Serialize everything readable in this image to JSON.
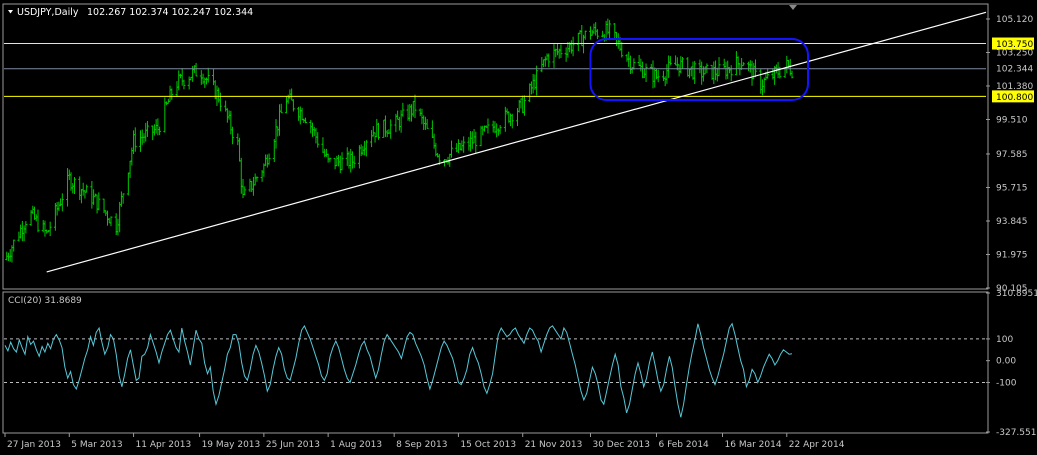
{
  "header": {
    "symbol": "USDJPY,Daily",
    "ohlc": "102.267 102.374 102.247 102.344"
  },
  "colors": {
    "background": "#000000",
    "candles": "#00c800",
    "cci_line": "#56c8d8",
    "support_resistance": "#ffff00",
    "trendline": "#ffffff",
    "range_box": "#1414ff",
    "grid": "#808080"
  },
  "chart_data": [
    {
      "type": "line",
      "title": "",
      "series_name": "USDJPY Daily (approx. closes)",
      "x": [
        "2013-01-27",
        "2013-02-10",
        "2013-02-20",
        "2013-03-05",
        "2013-03-20",
        "2013-04-01",
        "2013-04-11",
        "2013-04-25",
        "2013-05-05",
        "2013-05-19",
        "2013-05-30",
        "2013-06-10",
        "2013-06-13",
        "2013-06-25",
        "2013-07-08",
        "2013-07-20",
        "2013-08-01",
        "2013-08-15",
        "2013-08-25",
        "2013-09-08",
        "2013-09-20",
        "2013-10-05",
        "2013-10-15",
        "2013-10-28",
        "2013-11-08",
        "2013-11-21",
        "2013-12-05",
        "2013-12-18",
        "2013-12-30",
        "2014-01-10",
        "2014-01-23",
        "2014-02-06",
        "2014-02-18",
        "2014-03-02",
        "2014-03-16",
        "2014-03-28",
        "2014-04-07",
        "2014-04-22",
        "2014-04-25"
      ],
      "y": [
        91.7,
        94.3,
        93.1,
        96.2,
        95.0,
        93.6,
        98.3,
        99.0,
        101.5,
        102.3,
        100.8,
        98.1,
        95.1,
        96.9,
        100.7,
        99.6,
        97.1,
        97.2,
        98.8,
        99.2,
        100.2,
        97.3,
        97.8,
        98.6,
        99.4,
        100.3,
        103.0,
        103.6,
        104.4,
        104.4,
        102.6,
        101.9,
        102.6,
        102.1,
        102.2,
        102.8,
        101.5,
        102.5,
        102.3
      ],
      "y_ticks": [
        "105.120",
        "103.250",
        "101.380",
        "99.510",
        "97.585",
        "95.715",
        "93.845",
        "91.975",
        "90.105"
      ],
      "x_ticks": [
        "27 Jan 2013",
        "5 Mar 2013",
        "11 Apr 2013",
        "19 May 2013",
        "25 Jun 2013",
        "1 Aug 2013",
        "8 Sep 2013",
        "15 Oct 2013",
        "21 Nov 2013",
        "30 Dec 2013",
        "6 Feb 2014",
        "16 Mar 2014",
        "22 Apr 2014"
      ],
      "current_price": 102.344,
      "current_price_label": "102.344",
      "levels": [
        {
          "label": "103.750",
          "value": 103.75
        },
        {
          "label": "100.800",
          "value": 100.8
        }
      ],
      "trendline": {
        "from": [
          "2013-02-20",
          91.0
        ],
        "to": [
          "2014-04-25",
          102.5
        ]
      },
      "range_box": {
        "from": "2013-12-30",
        "to": "2014-04-25",
        "top": 104.0,
        "bottom": 100.6
      },
      "ylim": [
        90.105,
        105.9
      ],
      "grid": false
    },
    {
      "type": "line",
      "title": "CCI(20) 31.8689",
      "series_name": "CCI(20)",
      "y_ticks": [
        "310.8951",
        "100",
        "0.00",
        "-100",
        "-327.551"
      ],
      "reference_lines": [
        100,
        -100
      ],
      "ylim": [
        -327.551,
        310.8951
      ],
      "values": [
        70,
        45,
        85,
        55,
        40,
        95,
        60,
        30,
        110,
        75,
        90,
        50,
        20,
        65,
        40,
        80,
        55,
        100,
        120,
        95,
        60,
        -30,
        -80,
        -50,
        -110,
        -130,
        -90,
        -40,
        10,
        50,
        110,
        70,
        130,
        150,
        85,
        30,
        60,
        120,
        100,
        30,
        -70,
        -120,
        -60,
        10,
        50,
        -20,
        -90,
        -80,
        20,
        30,
        60,
        120,
        80,
        40,
        -10,
        40,
        80,
        120,
        140,
        100,
        60,
        40,
        150,
        90,
        40,
        -20,
        60,
        140,
        100,
        80,
        -10,
        -60,
        -30,
        -140,
        -200,
        -160,
        -100,
        -40,
        30,
        60,
        120,
        120,
        80,
        -10,
        -70,
        -90,
        -40,
        30,
        70,
        40,
        -10,
        -70,
        -140,
        -110,
        -40,
        20,
        60,
        30,
        -40,
        -80,
        -90,
        -40,
        10,
        80,
        140,
        160,
        130,
        100,
        60,
        20,
        -20,
        -70,
        -90,
        -60,
        20,
        60,
        90,
        60,
        10,
        -40,
        -80,
        -100,
        -60,
        -20,
        30,
        70,
        90,
        50,
        20,
        -30,
        -80,
        -40,
        30,
        90,
        120,
        100,
        80,
        60,
        40,
        10,
        60,
        110,
        130,
        120,
        80,
        50,
        20,
        -20,
        -80,
        -130,
        -90,
        -40,
        10,
        60,
        90,
        70,
        40,
        10,
        -40,
        -100,
        -110,
        -80,
        -40,
        30,
        60,
        20,
        -10,
        -60,
        -120,
        -150,
        -110,
        -60,
        30,
        120,
        150,
        130,
        110,
        120,
        140,
        150,
        120,
        100,
        80,
        120,
        150,
        140,
        110,
        90,
        40,
        80,
        120,
        150,
        160,
        140,
        120,
        100,
        150,
        130,
        80,
        30,
        -20,
        -80,
        -140,
        -180,
        -150,
        -90,
        -30,
        -60,
        -110,
        -180,
        -200,
        -140,
        -80,
        -20,
        30,
        -20,
        -120,
        -170,
        -240,
        -200,
        -130,
        -60,
        -10,
        -60,
        -120,
        -80,
        -10,
        40,
        -20,
        -90,
        -140,
        -110,
        -40,
        20,
        -30,
        -120,
        -200,
        -260,
        -200,
        -110,
        -30,
        40,
        100,
        170,
        120,
        60,
        10,
        -40,
        -80,
        -110,
        -70,
        -20,
        30,
        90,
        150,
        170,
        120,
        60,
        0,
        -40,
        -120,
        -90,
        -40,
        -60,
        -100,
        -70,
        -30,
        0,
        30,
        10,
        -20,
        0,
        30,
        50,
        40,
        30,
        31.9
      ]
    }
  ]
}
